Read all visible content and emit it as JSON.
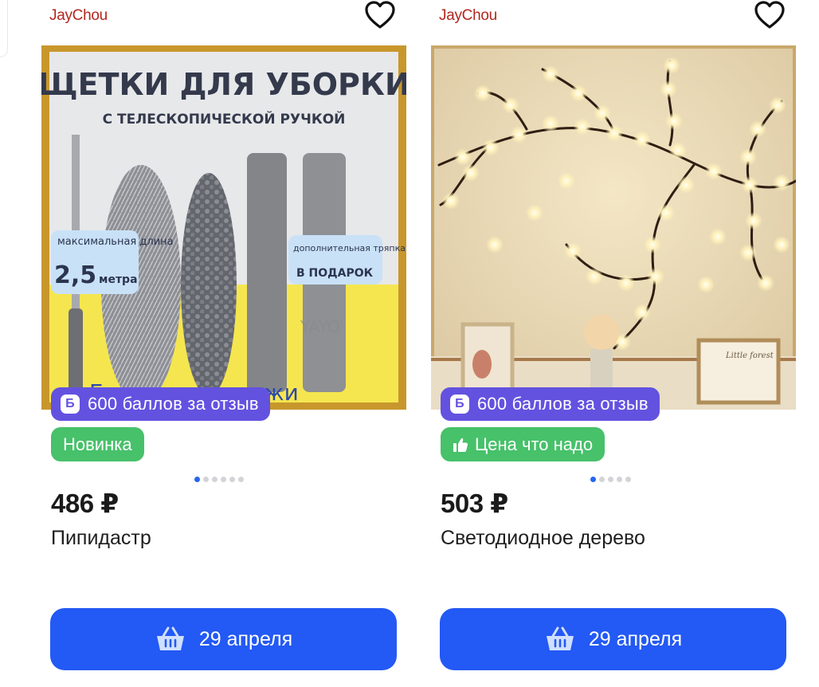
{
  "cards": [
    {
      "brand": "JayChou",
      "photo_text": {
        "heading": "ЩЕТКИ ДЛЯ УБОРКИ",
        "subheading": "С ТЕЛЕСКОПИЧЕСКОЙ РУЧКОЙ",
        "length_label": "максимальная длина",
        "length_value": "2,5",
        "length_unit": "метра",
        "extra_label": "дополнительная тряпка",
        "extra_gift": "В ПОДАРОК",
        "watermark": "YAYO",
        "footer": "Горячие продажи"
      },
      "points_badge": "600 баллов за отзыв",
      "points_icon": "Б",
      "tag": "Новинка",
      "tag_icon": "",
      "slides": 6,
      "active_slide": 0,
      "price": "486 ₽",
      "name": "Пипидастр",
      "delivery": "29 апреля"
    },
    {
      "brand": "JayChou",
      "photo_text": {
        "art_label": "Little forest"
      },
      "points_badge": "600 баллов за отзыв",
      "points_icon": "Б",
      "tag": "Цена что надо",
      "tag_icon": "thumbs-up-icon",
      "slides": 5,
      "active_slide": 0,
      "price": "503 ₽",
      "name": "Светодиодное дерево",
      "delivery": "29 апреля"
    }
  ],
  "colors": {
    "brand": "#b3261e",
    "points": "#6352e0",
    "tag": "#47c16a",
    "button": "#2359f4",
    "dot_active": "#2566f2"
  },
  "icons": {
    "favorite": "heart-outline-icon",
    "cart": "basket-icon"
  }
}
